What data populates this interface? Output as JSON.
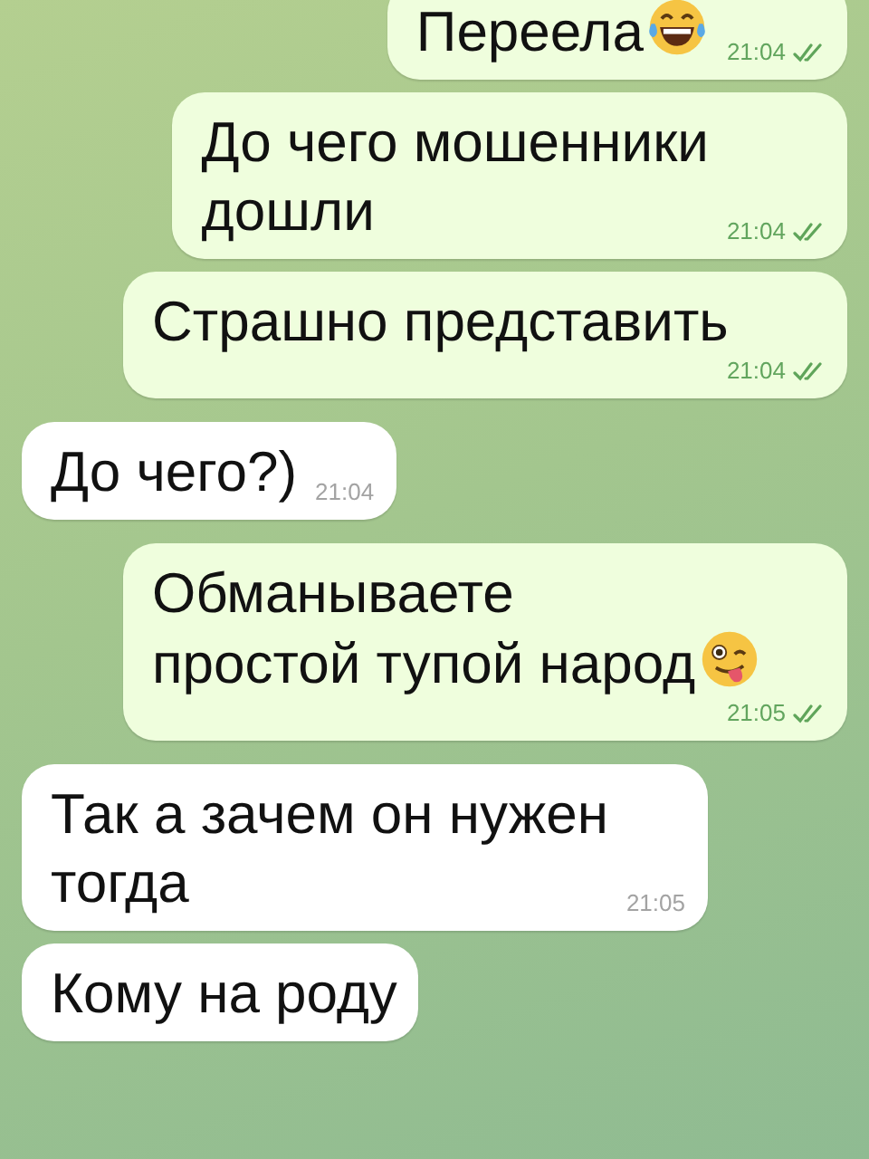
{
  "messages": [
    {
      "kind": "outgoing",
      "text": "Переела",
      "emoji": {
        "kind": "laugh"
      },
      "time": "21:04",
      "read": true
    },
    {
      "kind": "outgoing",
      "text": "До чего мошенники\nдошли",
      "time": "21:04",
      "read": true
    },
    {
      "kind": "outgoing",
      "text": "Страшно представить",
      "time": "21:04",
      "read": true
    },
    {
      "kind": "incoming",
      "text": "До чего?)",
      "time": "21:04"
    },
    {
      "kind": "outgoing",
      "text": "Обманываете\nпростой тупой народ",
      "emoji": {
        "kind": "wink"
      },
      "time": "21:05",
      "read": true
    },
    {
      "kind": "incoming",
      "text": "Так а зачем он нужен\nтогда",
      "time": "21:05"
    },
    {
      "kind": "incoming",
      "text": "Кому на роду"
    }
  ]
}
